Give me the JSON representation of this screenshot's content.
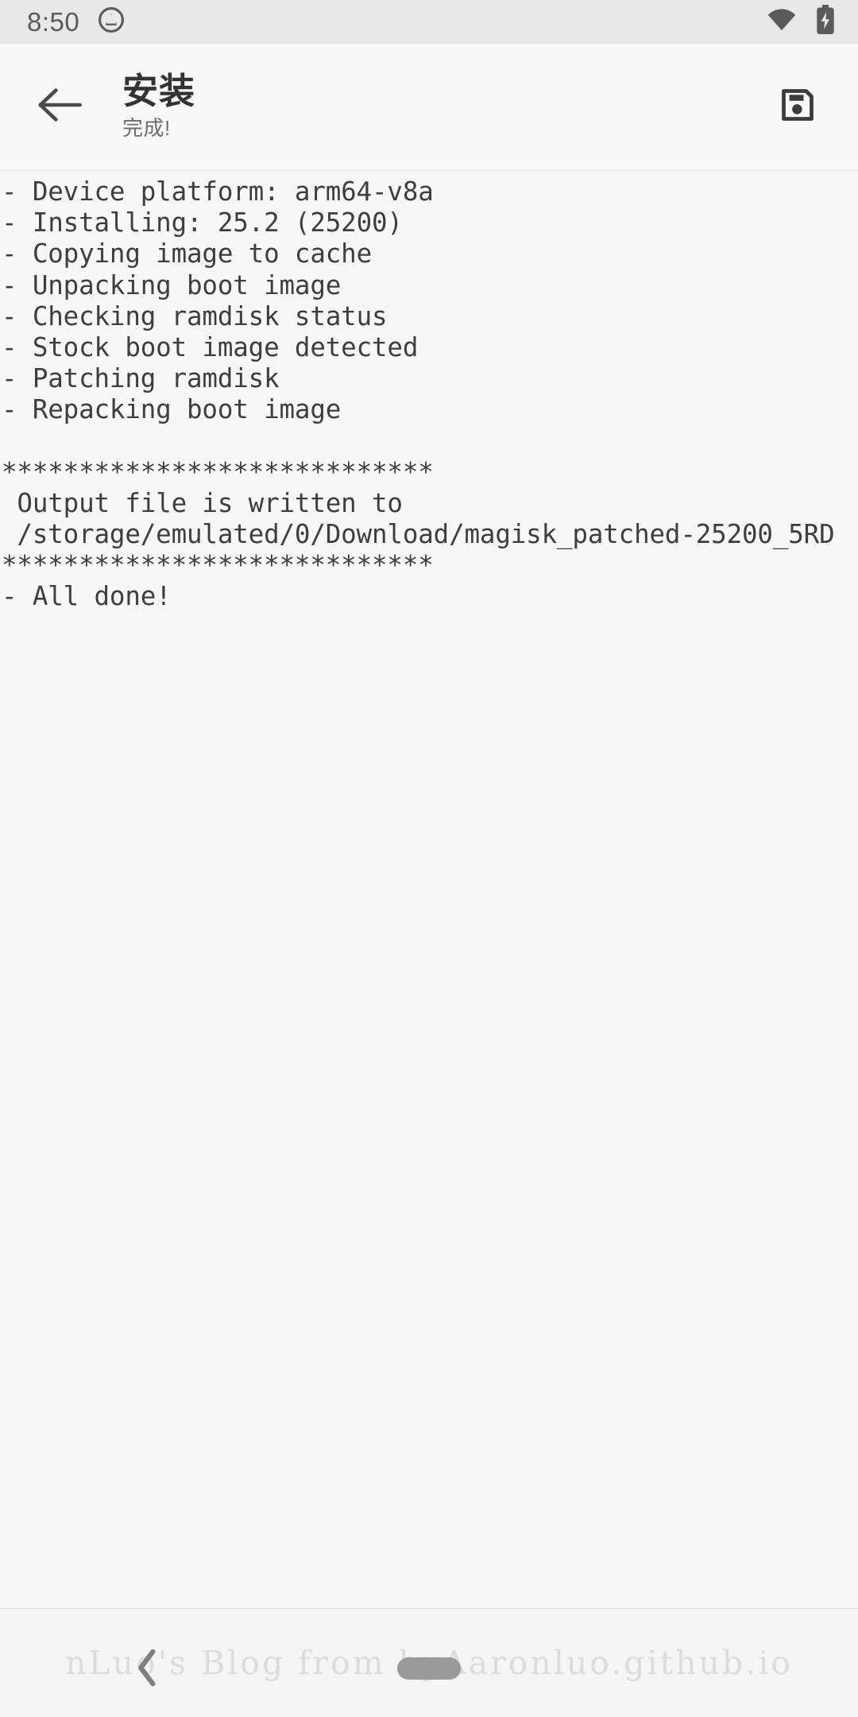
{
  "status_bar": {
    "clock": "8:50",
    "icons_left": [
      "magisk-circle-icon"
    ],
    "icons_right": [
      "wifi-icon",
      "battery-charging-icon"
    ],
    "background_color": "#e8e8e8",
    "foreground_color": "#5b5b5b"
  },
  "app_bar": {
    "back_icon": "arrow-left-icon",
    "title": "安装",
    "subtitle": "完成!",
    "action_icon": "save-icon",
    "background_color": "#f8f8f8"
  },
  "console": {
    "text_color": "#3e3e3e",
    "background_color": "#f7f7f7",
    "lines": [
      "- Device platform: arm64-v8a",
      "- Installing: 25.2 (25200)",
      "- Copying image to cache",
      "- Unpacking boot image",
      "- Checking ramdisk status",
      "- Stock boot image detected",
      "- Patching ramdisk",
      "- Repacking boot image",
      "",
      "****************************",
      " Output file is written to",
      " /storage/emulated/0/Download/magisk_patched-25200_5RD",
      "****************************",
      "- All done!"
    ]
  },
  "bottom": {
    "watermark": "nLuo's Blog from byAaronluo.github.io",
    "nav_back_icon": "chevron-left-icon",
    "nav_home_pill": "home-gesture-pill"
  }
}
